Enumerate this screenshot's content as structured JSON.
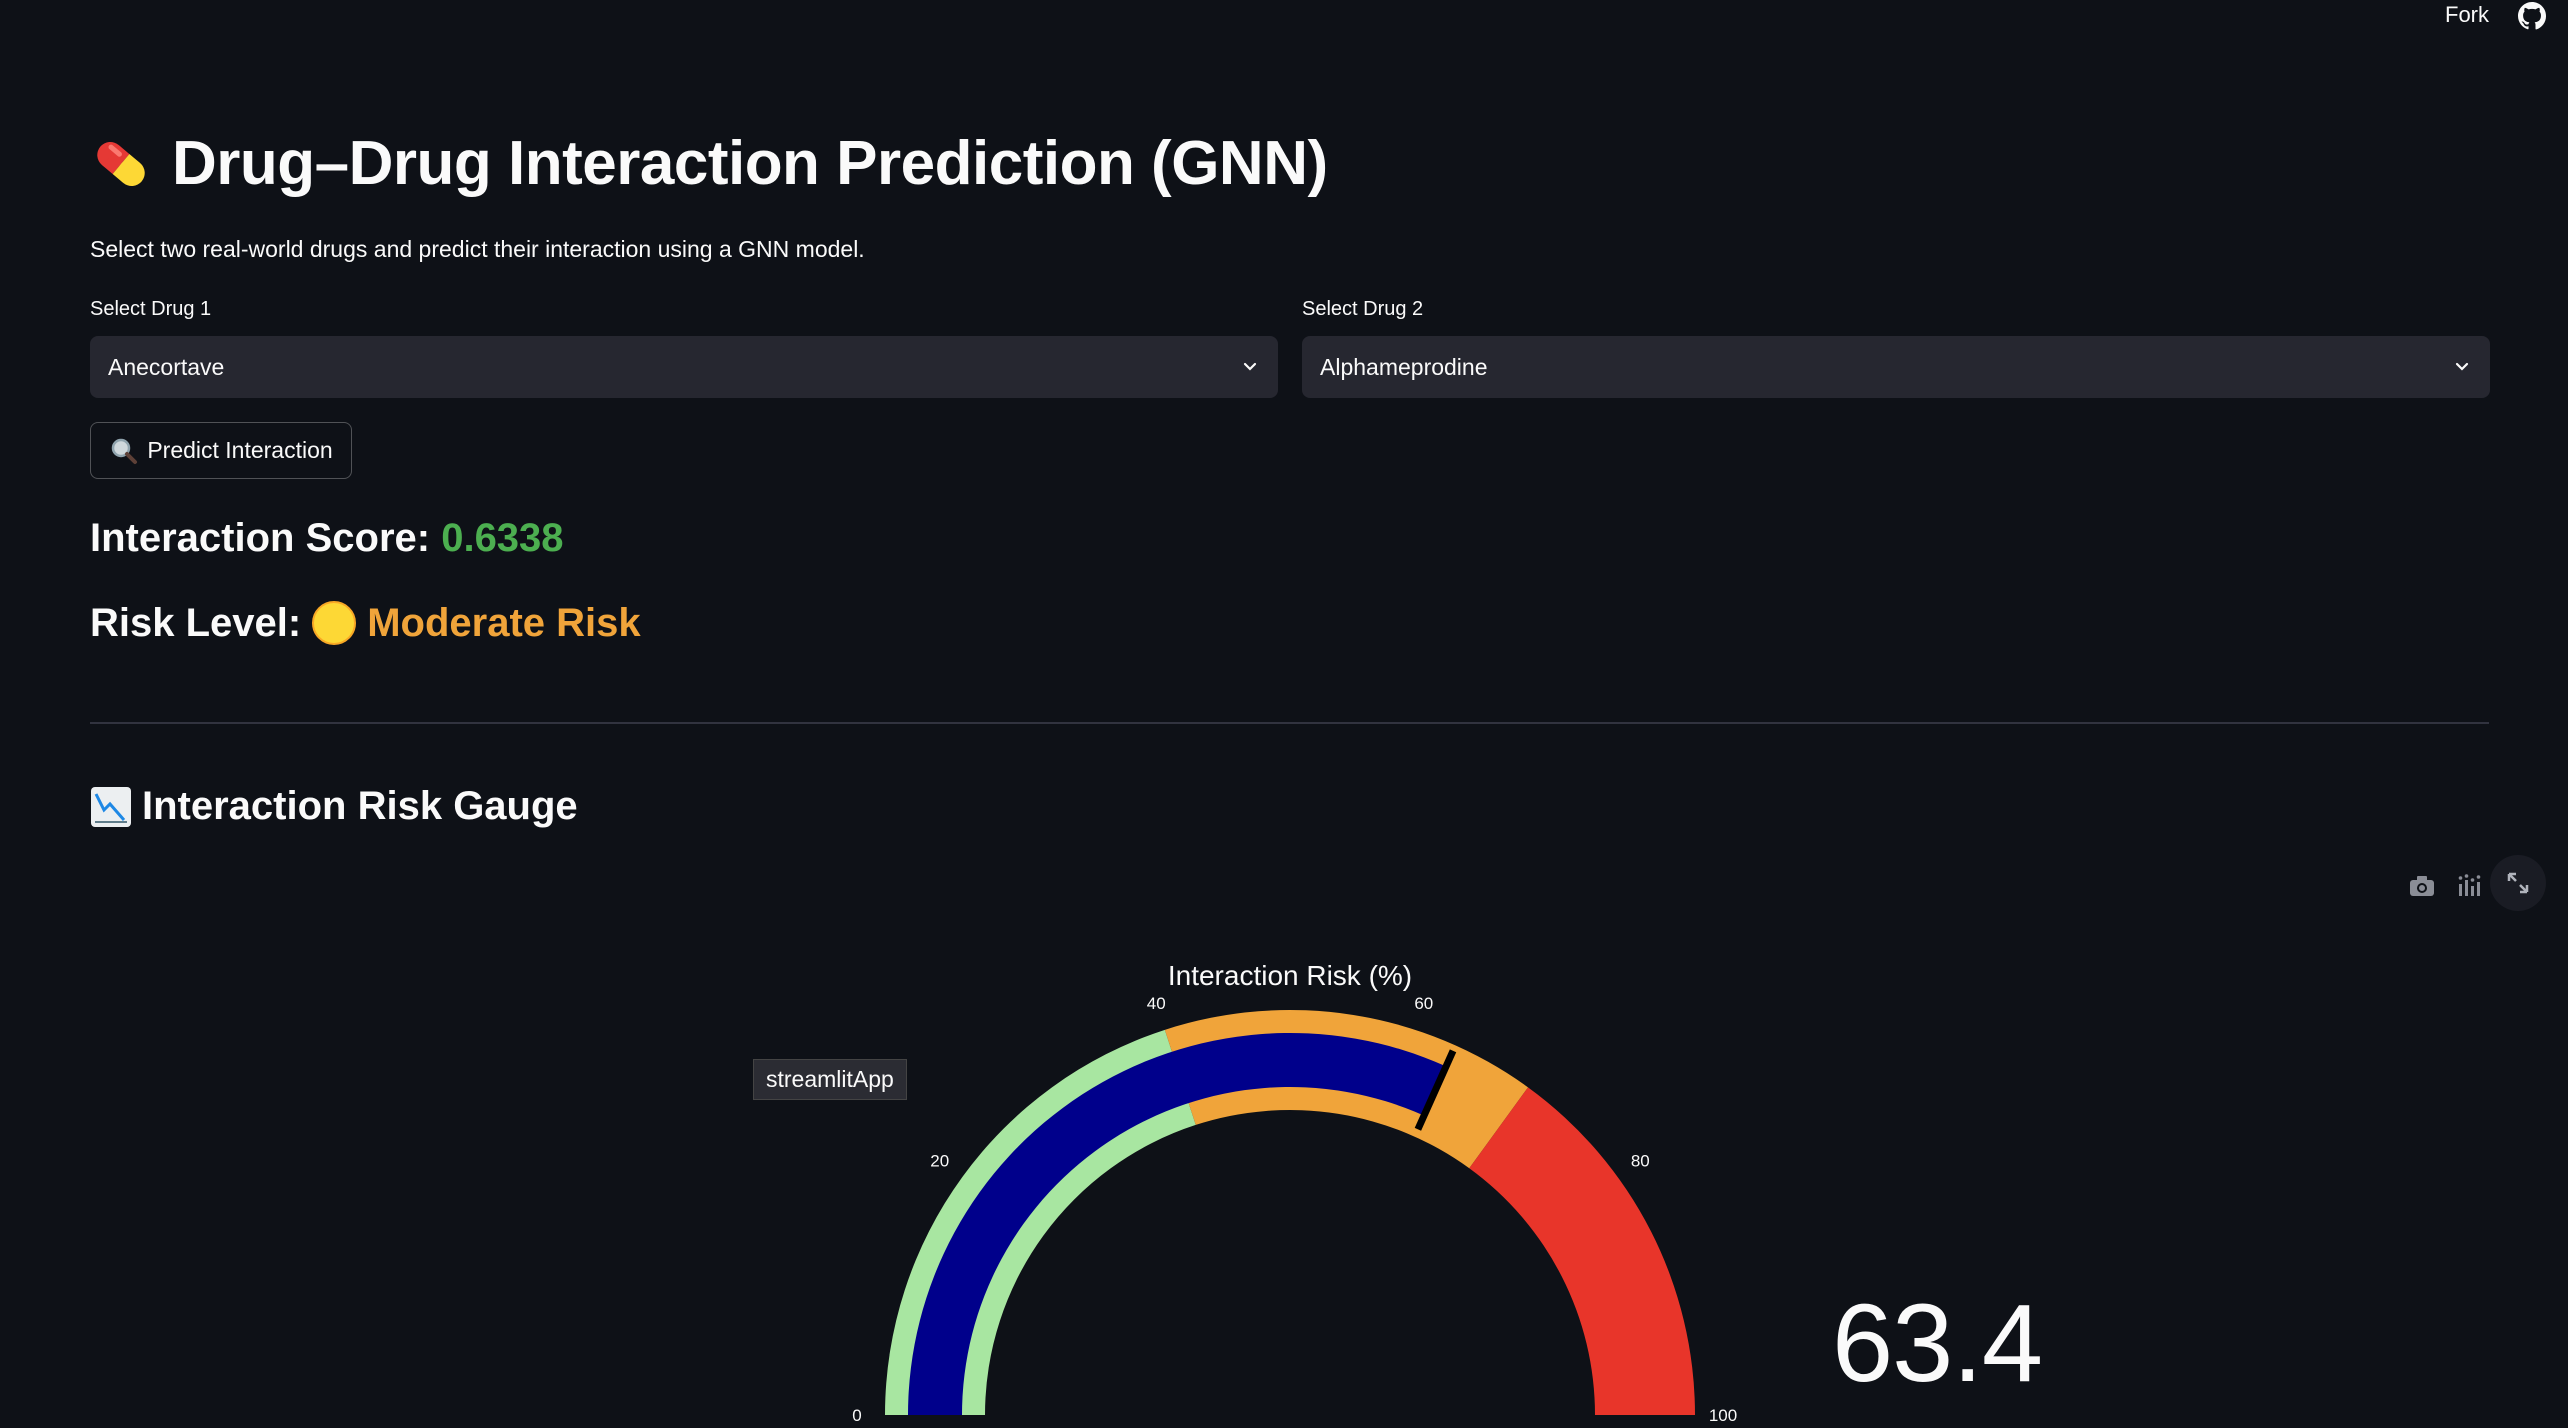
{
  "header": {
    "fork_label": "Fork"
  },
  "page": {
    "title": "Drug–Drug Interaction Prediction (GNN)",
    "subtitle": "Select two real-world drugs and predict their interaction using a GNN model."
  },
  "drug1": {
    "label": "Select Drug 1",
    "value": "Anecortave"
  },
  "drug2": {
    "label": "Select Drug 2",
    "value": "Alphameprodine"
  },
  "predict_button": {
    "label": "Predict Interaction",
    "icon": "magnifier-icon"
  },
  "score": {
    "label": "Interaction Score:",
    "value": "0.6338"
  },
  "risk": {
    "label": "Risk Level:",
    "value": "Moderate Risk",
    "icon": "yellow-circle-icon"
  },
  "gauge_section": {
    "heading": "Interaction Risk Gauge",
    "icon": "chart-decreasing-icon"
  },
  "tooltip": {
    "text": "streamlitApp"
  },
  "colors": {
    "background": "#0e1117",
    "score_green": "#4caf50",
    "risk_orange": "#f0a43a",
    "gauge_low": "#a8e6a1",
    "gauge_mid": "#f0a43a",
    "gauge_high": "#e8352a",
    "gauge_bar": "#00008b"
  },
  "chart_data": {
    "type": "gauge",
    "title": "Interaction Risk (%)",
    "value": 63.4,
    "value_text": "63.4",
    "range": [
      0,
      100
    ],
    "ticks": [
      "0",
      "20",
      "40",
      "60",
      "80",
      "100"
    ],
    "steps": [
      {
        "range": [
          0,
          40
        ],
        "color": "#a8e6a1"
      },
      {
        "range": [
          40,
          70
        ],
        "color": "#f0a43a"
      },
      {
        "range": [
          70,
          100
        ],
        "color": "#e8352a"
      }
    ],
    "threshold": 63.4
  }
}
